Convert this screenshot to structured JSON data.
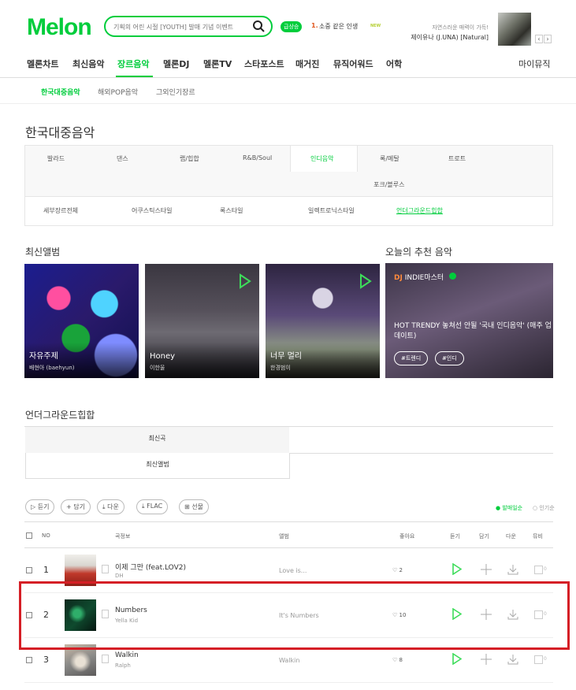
{
  "header": {
    "logo": "Melon",
    "search_placeholder": "기획의 어린 시절 [YOUTH] 발매 기념 이벤트",
    "live_badge": "급상승",
    "rank_number": "1.",
    "rank_title": "소중 같은 인생",
    "new_badge": "NEW",
    "promo_line1": "자연스러운 매력이 가득!",
    "promo_line2": "제이유나 (J.UNA) [Natural]",
    "prev_arrow": "‹",
    "next_arrow": "›"
  },
  "nav": {
    "items": [
      "멜론차트",
      "최신음악",
      "장르음악",
      "멜론DJ",
      "멜론TV",
      "스타포스트",
      "매거진",
      "뮤직어워드",
      "어학"
    ],
    "active": "장르음악",
    "my_music": "마이뮤직"
  },
  "subnav": {
    "items": [
      "한국대중음악",
      "해외POP음악",
      "그외인기장르"
    ],
    "active": "한국대중음악"
  },
  "page_title": "한국대중음악",
  "genres": {
    "row1": [
      "발라드",
      "댄스",
      "랩/힙합",
      "R&B/Soul",
      "인디음악",
      "록/메탈",
      "트로트"
    ],
    "row2": [
      "포크/블루스"
    ],
    "active": "인디음악",
    "sub": [
      "세부장르전체",
      "어쿠스틱스타일",
      "록스타일",
      "일렉트로닉스타일",
      "언더그라운드힙합"
    ],
    "sub_active": "언더그라운드힙합"
  },
  "latest_albums": {
    "title": "최신앨범",
    "items": [
      {
        "title": "자유주제",
        "artist": "배현아 (baehyun)"
      },
      {
        "title": "Honey",
        "artist": "이한울"
      },
      {
        "title": "너무 멀리",
        "artist": "한경범이"
      }
    ]
  },
  "recommend": {
    "title": "오늘의 추천 음악",
    "dj_prefix": "DJ",
    "dj_name": "INDIE마스터",
    "text": "HOT TRENDY 놓쳐선 안될 '국내 인디음악' (매주 업데이트)",
    "tags": [
      "#트렌디",
      "#인디"
    ]
  },
  "chart": {
    "title": "언더그라운드힙합",
    "tabs": [
      "최신곡",
      "최신앨범"
    ],
    "active_tab": "최신곡",
    "buttons": [
      "듣기",
      "담기",
      "다운",
      "FLAC",
      "선물"
    ],
    "sort": [
      "● 발매일순",
      "○ 인기순"
    ],
    "columns": {
      "no": "NO",
      "song": "곡정보",
      "album": "앨범",
      "like": "좋아요",
      "play": "듣기",
      "add": "담기",
      "down": "다운",
      "mv": "뮤비"
    },
    "rows": [
      {
        "no": "1",
        "title": "이제 그만 (feat.LOV2)",
        "artist": "DH",
        "album": "Love is...",
        "likes": "♡ 2",
        "mv": "0"
      },
      {
        "no": "2",
        "title": "Numbers",
        "artist": "Yella Kid",
        "album": "It's Numbers",
        "likes": "♡ 10",
        "mv": "0"
      },
      {
        "no": "3",
        "title": "Walkin",
        "artist": "Ralph",
        "album": "Walkin",
        "likes": "♡ 8",
        "mv": "0"
      }
    ]
  },
  "colors": {
    "brand": "#00cd3c",
    "highlight": "#d51f26"
  },
  "icons": [
    "search-icon",
    "play-icon",
    "plus-icon",
    "download-icon",
    "heart-icon",
    "info-icon",
    "mv-icon",
    "gift-icon"
  ]
}
